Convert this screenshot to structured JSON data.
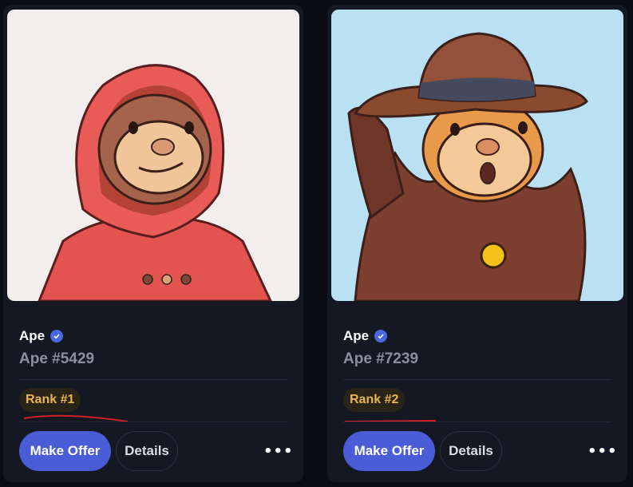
{
  "cards": [
    {
      "collection": "Ape",
      "verified_icon": "verified-badge-icon",
      "token_name": "Ape #5429",
      "rank": "Rank #1",
      "make_offer_label": "Make Offer",
      "details_label": "Details",
      "more_label": "•••",
      "background_color": "#f3eeee",
      "accent_color": "#e35450"
    },
    {
      "collection": "Ape",
      "verified_icon": "verified-badge-icon",
      "token_name": "Ape #7239",
      "rank": "Rank #2",
      "make_offer_label": "Make Offer",
      "details_label": "Details",
      "more_label": "•••",
      "background_color": "#b9e1f3",
      "accent_color": "#8a4a2e"
    }
  ],
  "colors": {
    "page_bg": "#0b0d14",
    "card_bg": "#141823",
    "primary_button": "#4a5cd6",
    "rank_text": "#e8b54b",
    "annotation_red": "#d0202a"
  }
}
